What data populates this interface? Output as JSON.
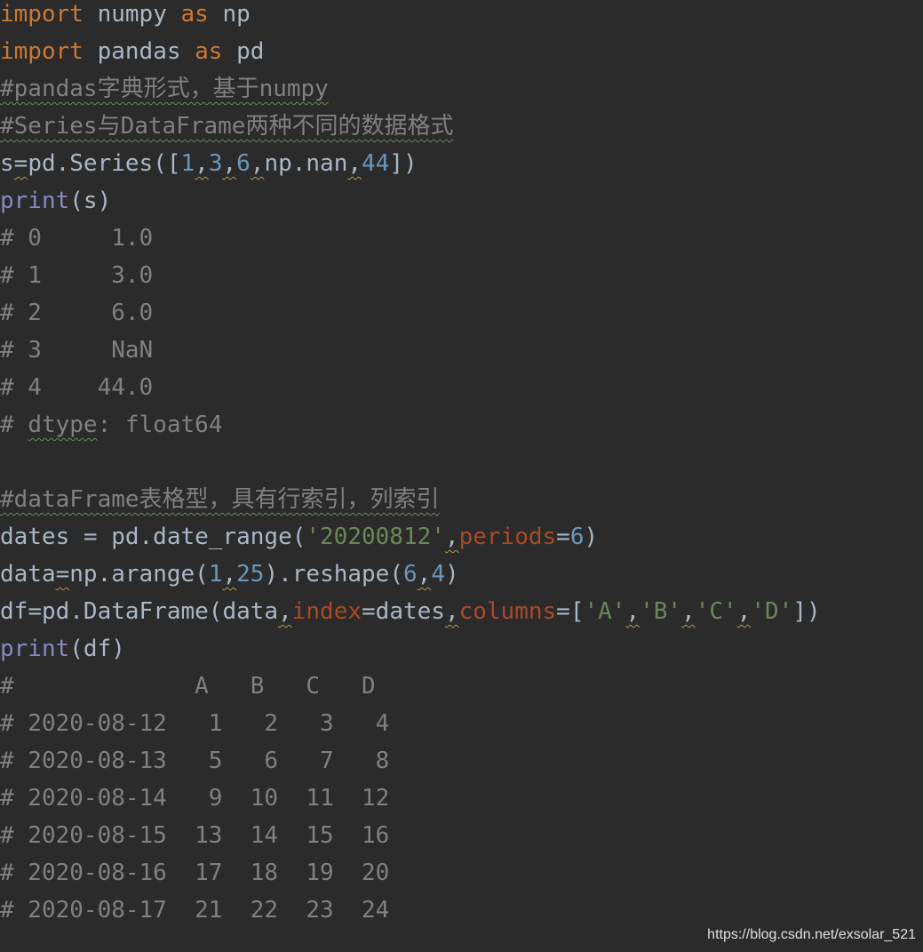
{
  "code_lines": [
    [
      {
        "t": "import",
        "c": "kw"
      },
      {
        "t": " numpy ",
        "c": "pl"
      },
      {
        "t": "as",
        "c": "kw"
      },
      {
        "t": " np",
        "c": "pl"
      }
    ],
    [
      {
        "t": "import",
        "c": "kw"
      },
      {
        "t": " pandas ",
        "c": "pl"
      },
      {
        "t": "as",
        "c": "kw"
      },
      {
        "t": " pd",
        "c": "pl"
      }
    ],
    [
      {
        "t": "#pandas字典形式，基于numpy",
        "c": "cm",
        "u": "wavy"
      }
    ],
    [
      {
        "t": "#Series与DataFrame两种不同的数据格式",
        "c": "cm",
        "u": "wavy"
      }
    ],
    [
      {
        "t": "s",
        "c": "pl"
      },
      {
        "t": "=",
        "c": "pl",
        "u": "weak"
      },
      {
        "t": "pd.Series([",
        "c": "pl"
      },
      {
        "t": "1",
        "c": "num"
      },
      {
        "t": ",",
        "c": "pl",
        "u": "weak"
      },
      {
        "t": "3",
        "c": "num"
      },
      {
        "t": ",",
        "c": "pl",
        "u": "weak"
      },
      {
        "t": "6",
        "c": "num"
      },
      {
        "t": ",",
        "c": "pl",
        "u": "weak"
      },
      {
        "t": "np.nan",
        "c": "pl"
      },
      {
        "t": ",",
        "c": "pl",
        "u": "weak"
      },
      {
        "t": "44",
        "c": "num"
      },
      {
        "t": "])",
        "c": "pl"
      }
    ],
    [
      {
        "t": "print",
        "c": "bi"
      },
      {
        "t": "(s)",
        "c": "pl"
      }
    ],
    [
      {
        "t": "# 0     1.0",
        "c": "cm"
      }
    ],
    [
      {
        "t": "# 1     3.0",
        "c": "cm"
      }
    ],
    [
      {
        "t": "# 2     6.0",
        "c": "cm"
      }
    ],
    [
      {
        "t": "# 3     NaN",
        "c": "cm"
      }
    ],
    [
      {
        "t": "# 4    44.0",
        "c": "cm"
      }
    ],
    [
      {
        "t": "# ",
        "c": "cm"
      },
      {
        "t": "dtype",
        "c": "cm",
        "u": "wavy"
      },
      {
        "t": ": float64",
        "c": "cm"
      }
    ],
    [],
    [
      {
        "t": "#dataFrame表格型，具有行索引，列索引",
        "c": "cm",
        "u": "wavy"
      }
    ],
    [
      {
        "t": "dates = pd.date_range(",
        "c": "pl"
      },
      {
        "t": "'20200812'",
        "c": "str"
      },
      {
        "t": ",",
        "c": "pl",
        "u": "weak"
      },
      {
        "t": "periods",
        "c": "param"
      },
      {
        "t": "=",
        "c": "pl"
      },
      {
        "t": "6",
        "c": "num"
      },
      {
        "t": ")",
        "c": "pl"
      }
    ],
    [
      {
        "t": "data",
        "c": "pl"
      },
      {
        "t": "=",
        "c": "pl",
        "u": "weak"
      },
      {
        "t": "np.arange(",
        "c": "pl"
      },
      {
        "t": "1",
        "c": "num"
      },
      {
        "t": ",",
        "c": "pl",
        "u": "weak"
      },
      {
        "t": "25",
        "c": "num"
      },
      {
        "t": ").reshape(",
        "c": "pl"
      },
      {
        "t": "6",
        "c": "num"
      },
      {
        "t": ",",
        "c": "pl",
        "u": "weak"
      },
      {
        "t": "4",
        "c": "num"
      },
      {
        "t": ")",
        "c": "pl"
      }
    ],
    [
      {
        "t": "df",
        "c": "pl"
      },
      {
        "t": "=",
        "c": "pl"
      },
      {
        "t": "pd.DataFrame(data",
        "c": "pl"
      },
      {
        "t": ",",
        "c": "pl",
        "u": "weak"
      },
      {
        "t": "index",
        "c": "param"
      },
      {
        "t": "=dates",
        "c": "pl"
      },
      {
        "t": ",",
        "c": "pl",
        "u": "weak"
      },
      {
        "t": "columns",
        "c": "param"
      },
      {
        "t": "=[",
        "c": "pl"
      },
      {
        "t": "'A'",
        "c": "str"
      },
      {
        "t": ",",
        "c": "pl",
        "u": "weak"
      },
      {
        "t": "'B'",
        "c": "str"
      },
      {
        "t": ",",
        "c": "pl",
        "u": "weak"
      },
      {
        "t": "'C'",
        "c": "str"
      },
      {
        "t": ",",
        "c": "pl",
        "u": "weak"
      },
      {
        "t": "'D'",
        "c": "str"
      },
      {
        "t": "])",
        "c": "pl"
      }
    ],
    [
      {
        "t": "print",
        "c": "bi"
      },
      {
        "t": "(df)",
        "c": "pl"
      }
    ],
    [
      {
        "t": "#             A   B   C   D",
        "c": "cm"
      }
    ],
    [
      {
        "t": "# 2020-08-12   1   2   3   4",
        "c": "cm"
      }
    ],
    [
      {
        "t": "# 2020-08-13   5   6   7   8",
        "c": "cm"
      }
    ],
    [
      {
        "t": "# 2020-08-14   9  10  11  12",
        "c": "cm"
      }
    ],
    [
      {
        "t": "# 2020-08-15  13  14  15  16",
        "c": "cm"
      }
    ],
    [
      {
        "t": "# 2020-08-16  17  18  19  20",
        "c": "cm"
      }
    ],
    [
      {
        "t": "# 2020-08-17  21  22  23  24",
        "c": "cm"
      }
    ]
  ],
  "watermark": "https://blog.csdn.net/exsolar_521",
  "colors": {
    "background": "#2b2b2b",
    "keyword": "#cc7832",
    "plain": "#a9b7c6",
    "comment": "#808080",
    "number": "#6897bb",
    "string": "#6a8759",
    "parameter": "#aa4926",
    "builtin": "#8888c6"
  }
}
